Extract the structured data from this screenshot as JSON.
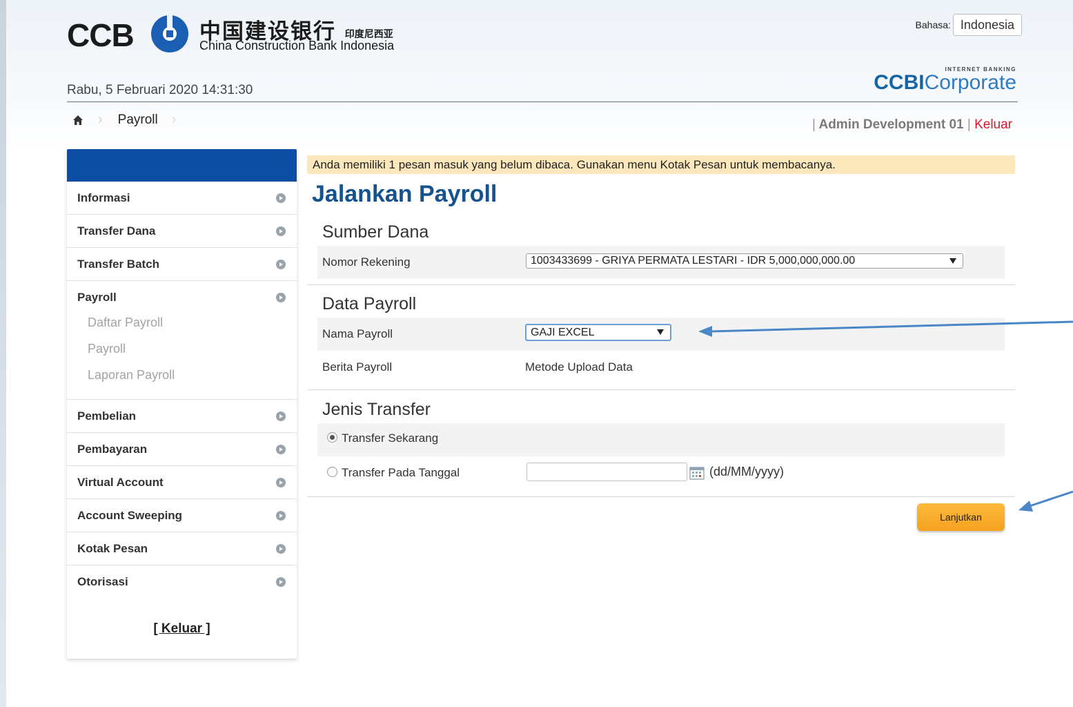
{
  "header": {
    "logo_ccb": "CCB",
    "logo_chinese": "中国建设银行",
    "logo_chinese_small": "印度尼西亚",
    "logo_english": "China Construction Bank Indonesia",
    "datetime": "Rabu, 5 Februari 2020 14:31:30",
    "language_label": "Bahasa:",
    "language_value": "Indonesia",
    "brand_small": "INTERNET BANKING",
    "brand_ccbi": "CCBI",
    "brand_corporate": "Corporate",
    "user_prefix": "|",
    "user_name": "Admin Development 01",
    "user_sep": "|",
    "logout_label": "Keluar"
  },
  "breadcrumb": {
    "current": "Payroll"
  },
  "sidebar": {
    "items": [
      {
        "label": "Informasi"
      },
      {
        "label": "Transfer Dana"
      },
      {
        "label": "Transfer Batch"
      },
      {
        "label": "Payroll"
      },
      {
        "label": "Pembelian"
      },
      {
        "label": "Pembayaran"
      },
      {
        "label": "Virtual Account"
      },
      {
        "label": "Account Sweeping"
      },
      {
        "label": "Kotak Pesan"
      },
      {
        "label": "Otorisasi"
      }
    ],
    "payroll_sub": [
      "Daftar Payroll",
      "Payroll",
      "Laporan Payroll"
    ],
    "logout": "[ Keluar ]"
  },
  "main": {
    "notice": "Anda memiliki 1 pesan masuk yang belum dibaca. Gunakan menu Kotak Pesan untuk membacanya.",
    "title": "Jalankan Payroll",
    "sumber_dana": {
      "heading": "Sumber Dana",
      "nomor_rekening_label": "Nomor Rekening",
      "nomor_rekening_value": "1003433699 - GRIYA PERMATA LESTARI - IDR 5,000,000,000.00"
    },
    "data_payroll": {
      "heading": "Data Payroll",
      "nama_label": "Nama Payroll",
      "nama_value": "GAJI EXCEL",
      "berita_label": "Berita Payroll",
      "berita_value": "Metode Upload Data"
    },
    "jenis_transfer": {
      "heading": "Jenis Transfer",
      "option_now": "Transfer Sekarang",
      "option_date": "Transfer Pada Tanggal",
      "date_format": "(dd/MM/yyyy)",
      "selected": "Transfer Sekarang"
    },
    "next_button": "Lanjutkan"
  },
  "colors": {
    "primary_blue": "#0d4ea5",
    "title_blue": "#15538f",
    "button_orange": "#f5a11f",
    "notice_bg": "#fde7bc",
    "logout_red": "#d8192a"
  }
}
